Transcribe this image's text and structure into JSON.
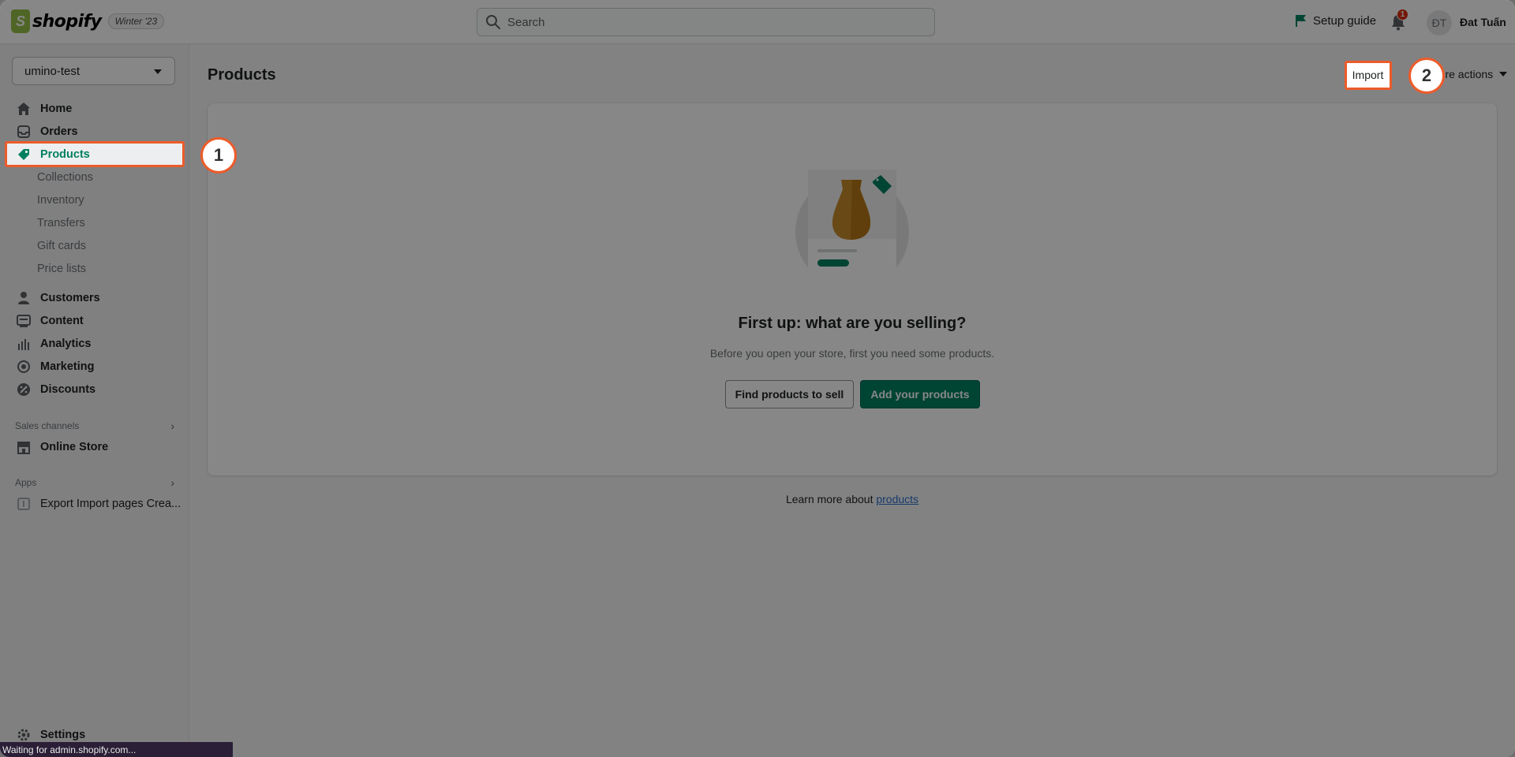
{
  "topbar": {
    "logo_text": "shopify",
    "version_badge": "Winter '23",
    "search_placeholder": "Search",
    "setup_guide": "Setup guide",
    "notification_count": "1",
    "avatar_initials": "ĐT",
    "user_name": "Đat Tuấn"
  },
  "sidebar": {
    "store_name": "umino-test",
    "items": [
      {
        "label": "Home",
        "icon": "home-icon"
      },
      {
        "label": "Orders",
        "icon": "inbox-icon"
      },
      {
        "label": "Products",
        "icon": "tag-icon",
        "active": true
      },
      {
        "label": "Customers",
        "icon": "person-icon"
      },
      {
        "label": "Content",
        "icon": "content-icon"
      },
      {
        "label": "Analytics",
        "icon": "bar-chart-icon"
      },
      {
        "label": "Marketing",
        "icon": "target-icon"
      },
      {
        "label": "Discounts",
        "icon": "discount-icon"
      }
    ],
    "product_subitems": [
      "Collections",
      "Inventory",
      "Transfers",
      "Gift cards",
      "Price lists"
    ],
    "sales_channels_title": "Sales channels",
    "online_store": "Online Store",
    "apps_title": "Apps",
    "app_item": "Export Import pages Crea...",
    "settings": "Settings"
  },
  "main": {
    "page_title": "Products",
    "import_label": "Import",
    "more_actions_label": "More actions",
    "empty_title": "First up: what are you selling?",
    "empty_desc": "Before you open your store, first you need some products.",
    "find_products_button": "Find products to sell",
    "add_products_button": "Add your products",
    "learn_more_prefix": "Learn more about",
    "learn_more_link": "products"
  },
  "annotations": {
    "step1": "1",
    "step2": "2",
    "highlight_color": "#ec5b2a"
  },
  "status_bar": "Waiting for admin.shopify.com...",
  "colors": {
    "brand_green": "#008060",
    "active_text": "#008060",
    "notification_red": "#d82c0d"
  }
}
